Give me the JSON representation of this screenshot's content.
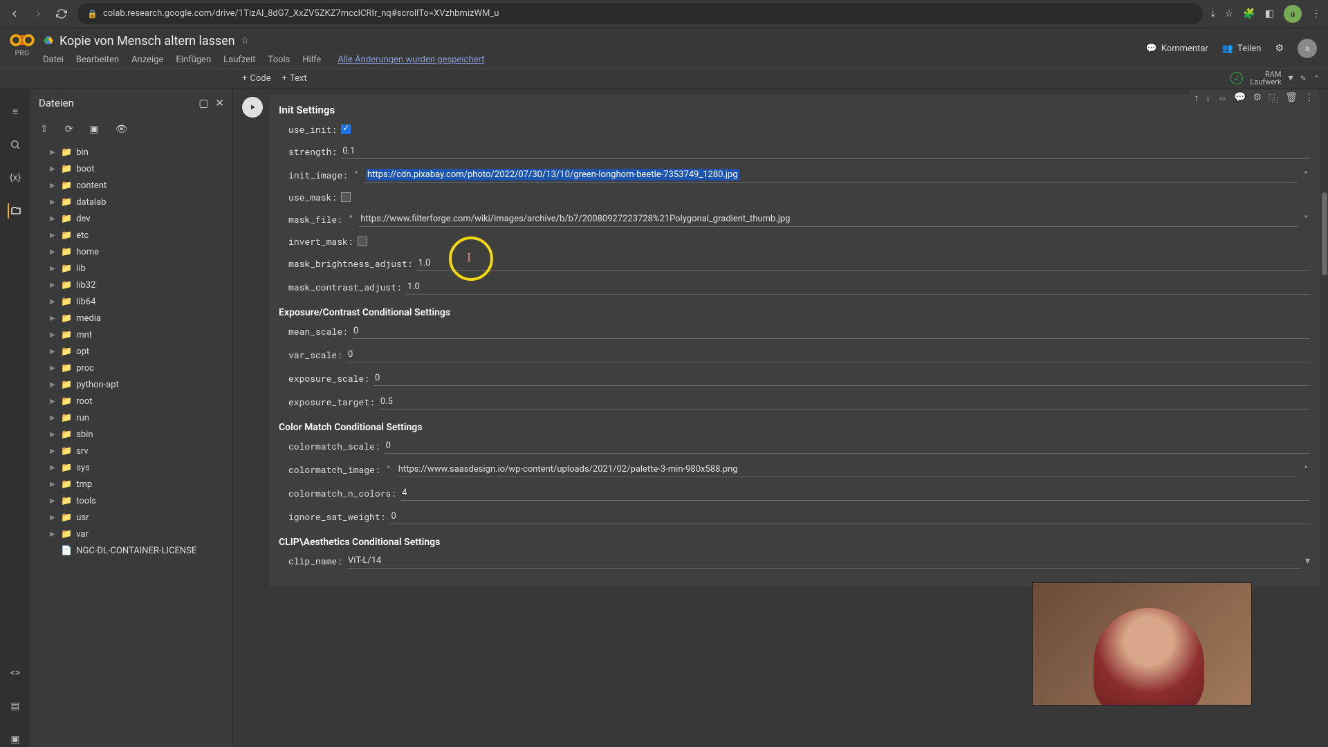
{
  "chrome": {
    "url": "colab.research.google.com/drive/1TizAl_8dG7_XxZV5ZKZ7mcclCRIr_nq#scrollTo=XVzhbmizWM_u",
    "avatar": "a"
  },
  "header": {
    "pro": "PRO",
    "title": "Kopie von Mensch altern lassen",
    "menu": {
      "file": "Datei",
      "edit": "Bearbeiten",
      "view": "Anzeige",
      "insert": "Einfügen",
      "runtime": "Laufzeit",
      "tools": "Tools",
      "help": "Hilfe"
    },
    "saved": "Alle Änderungen wurden gespeichert",
    "comment": "Kommentar",
    "share": "Teilen",
    "avatar": "a"
  },
  "toolbar": {
    "code": "Code",
    "text": "Text",
    "ram": "RAM",
    "disk": "Laufwerk"
  },
  "filepanel": {
    "title": "Dateien",
    "folders": [
      "bin",
      "boot",
      "content",
      "datalab",
      "dev",
      "etc",
      "home",
      "lib",
      "lib32",
      "lib64",
      "media",
      "mnt",
      "opt",
      "proc",
      "python-apt",
      "root",
      "run",
      "sbin",
      "srv",
      "sys",
      "tmp",
      "tools",
      "usr",
      "var"
    ],
    "file": "NGC-DL-CONTAINER-LICENSE"
  },
  "cell": {
    "title": "Init Settings",
    "use_init_label": "use_init:",
    "use_init": true,
    "strength_label": "strength:",
    "strength": "0.1",
    "init_image_label": "init_image:",
    "init_image": "https://cdn.pixabay.com/photo/2022/07/30/13/10/green-longhorn-beetle-7353749_1280.jpg",
    "use_mask_label": "use_mask:",
    "use_mask": false,
    "mask_file_label": "mask_file:",
    "mask_file": "https://www.filterforge.com/wiki/images/archive/b/b7/20080927223728%21Polygonal_gradient_thumb.jpg",
    "invert_mask_label": "invert_mask:",
    "invert_mask": false,
    "mask_brightness_label": "mask_brightness_adjust:",
    "mask_brightness": "1.0",
    "mask_contrast_label": "mask_contrast_adjust:",
    "mask_contrast": "1.0",
    "sec_exposure": "Exposure/Contrast Conditional Settings",
    "mean_scale_label": "mean_scale:",
    "mean_scale": "0",
    "var_scale_label": "var_scale:",
    "var_scale": "0",
    "exposure_scale_label": "exposure_scale:",
    "exposure_scale": "0",
    "exposure_target_label": "exposure_target:",
    "exposure_target": "0.5",
    "sec_color": "Color Match Conditional Settings",
    "colormatch_scale_label": "colormatch_scale:",
    "colormatch_scale": "0",
    "colormatch_image_label": "colormatch_image:",
    "colormatch_image": "https://www.saasdesign.io/wp-content/uploads/2021/02/palette-3-min-980x588.png",
    "colormatch_n_label": "colormatch_n_colors:",
    "colormatch_n": "4",
    "ignore_sat_label": "ignore_sat_weight:",
    "ignore_sat": "0",
    "sec_clip": "CLIP\\Aesthetics Conditional Settings",
    "clip_name_label": "clip_name:",
    "clip_name": "ViT-L/14"
  },
  "cursor": "I"
}
